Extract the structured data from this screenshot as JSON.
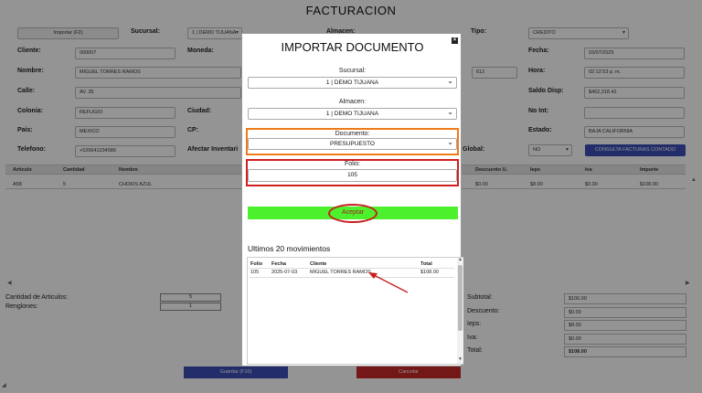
{
  "page": {
    "title": "FACTURACION"
  },
  "form": {
    "import_button": "Importar (F2)",
    "labels": {
      "sucursal": "Sucursal:",
      "almacen": "Almacen:",
      "tipo": "Tipo:",
      "cliente": "Cliente:",
      "moneda": "Moneda:",
      "fecha": "Fecha:",
      "nombre": "Nombre:",
      "hora": "Hora:",
      "calle": "Calle:",
      "saldo_disp": "Saldo Disp:",
      "colonia": "Colonia:",
      "ciudad": "Ciudad:",
      "no_int": "No Int:",
      "pais": "Pais:",
      "cp": "CP:",
      "estado": "Estado:",
      "telefono": "Telefono:",
      "afectar_inventario": "Afectar Inventari",
      "global": "Global:"
    },
    "values": {
      "sucursal": "1 | DEMO TIJUANA",
      "almacen": "1 | DEMO TIJUANA",
      "tipo": "CREDITO",
      "cliente": "000007",
      "fecha": "03/07/2025",
      "nombre": "MIGUEL TORRES RAMOS",
      "no_ext": "612",
      "hora": "02:12:53 p. m.",
      "calle": "AV. 35",
      "saldo_disp": "$462,318.42",
      "colonia": "REFUGIO",
      "pais": "MEXICO",
      "estado": "BAJA CALIFORNIA",
      "telefono": "+526641234586",
      "global": "NO"
    },
    "consulta_button": "CONSULTA FACTURAS CONTADO"
  },
  "grid": {
    "columns": [
      "Articulo",
      "Cantidad",
      "Nombre",
      "Descuento U.",
      "Ieps",
      "Iva",
      "Importe"
    ],
    "rows": [
      {
        "articulo": "A58",
        "cantidad": "5",
        "nombre": "CHOKIS AZUL",
        "descuento": "$0.00",
        "ieps": "$8.00",
        "iva": "$0.00",
        "importe": "$108.00"
      }
    ]
  },
  "summary": {
    "cantidad_label": "Cantidad de Articulos:",
    "cantidad_value": "5",
    "renglones_label": "Renglones:",
    "renglones_value": "1"
  },
  "totals": {
    "subtotal_label": "Subtotal:",
    "subtotal": "$100.00",
    "descuento_label": "Descuento:",
    "descuento": "$0.00",
    "ieps_label": "Ieps:",
    "ieps": "$8.00",
    "iva_label": "Iva:",
    "iva": "$0.00",
    "total_label": "Total:",
    "total": "$108.00"
  },
  "actions": {
    "guardar": "Guardar (F10)",
    "cancelar": "Cancelar"
  },
  "modal": {
    "title": "IMPORTAR DOCUMENTO",
    "close": "×",
    "sucursal_label": "Sucursal:",
    "sucursal_value": "1 | DEMO TIJUANA",
    "almacen_label": "Almacen:",
    "almacen_value": "1 | DEMO TIJUANA",
    "documento_label": "Documento:",
    "documento_value": "PRESUPUESTO",
    "folio_label": "Folio:",
    "folio_value": "105",
    "aceptar": "Aceptar",
    "movimientos_title": "Ultimos 20 movimientos",
    "movimientos_columns": [
      "Folio",
      "Fecha",
      "Cliente",
      "Total"
    ],
    "movimientos": [
      {
        "folio": "105",
        "fecha": "2025-07-03",
        "cliente": "MIGUEL TORRES RAMOS",
        "total": "$108.00"
      }
    ]
  },
  "colors": {
    "accent_blue": "#3c4fb6",
    "danger_red": "#c82828",
    "accept_green": "#4df02c",
    "highlight_orange": "#f07a18",
    "highlight_red": "#d11f1f"
  }
}
